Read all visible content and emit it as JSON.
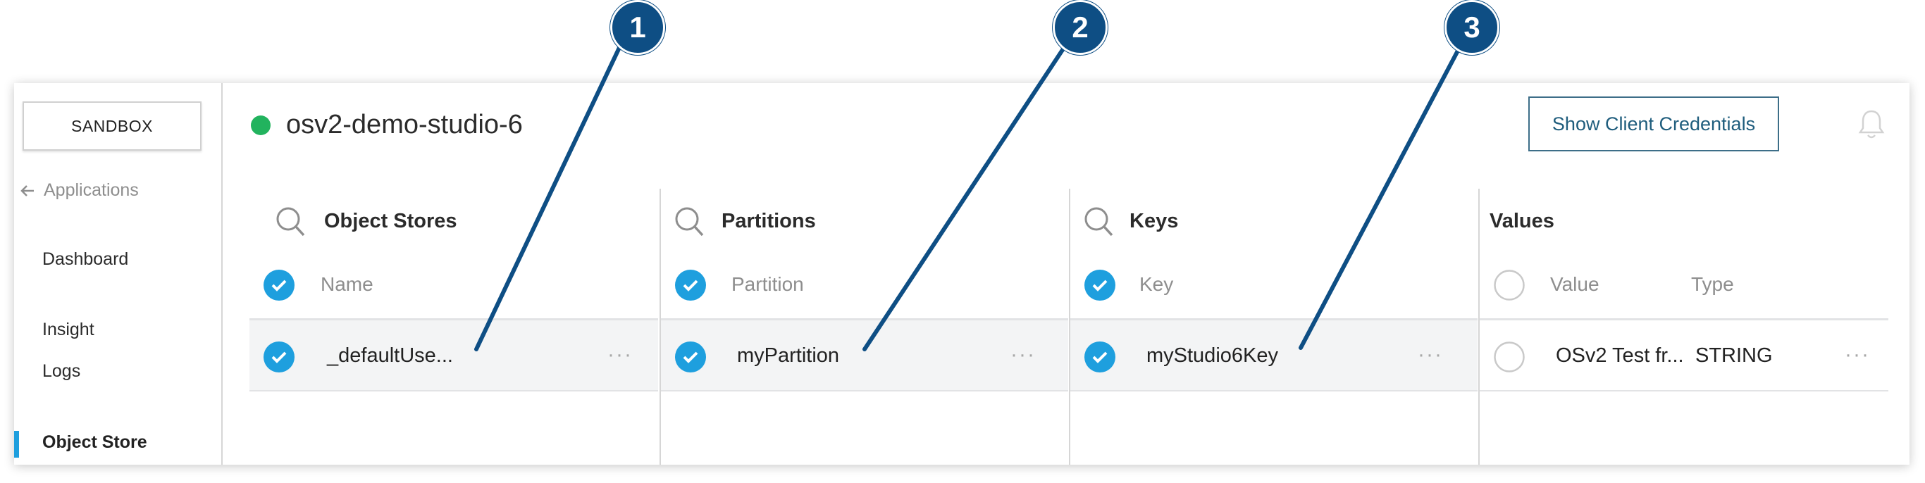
{
  "sidebar": {
    "environment": "SANDBOX",
    "back_label": "Applications",
    "items": [
      {
        "label": "Dashboard"
      },
      {
        "label": "Insight"
      },
      {
        "label": "Logs"
      },
      {
        "label": "Object Store",
        "active": true
      }
    ]
  },
  "header": {
    "app_name": "osv2-demo-studio-6",
    "status_color": "#22b35e",
    "credentials_button": "Show Client Credentials"
  },
  "columns": [
    {
      "title": "Object Stores",
      "header_label": "Name",
      "row_value": "_defaultUse..."
    },
    {
      "title": "Partitions",
      "header_label": "Partition",
      "row_value": "myPartition"
    },
    {
      "title": "Keys",
      "header_label": "Key",
      "row_value": "myStudio6Key"
    },
    {
      "title": "Values",
      "header_value_label": "Value",
      "header_type_label": "Type",
      "row_value": "OSv2 Test fr...",
      "row_type": "STRING"
    }
  ],
  "callouts": [
    "1",
    "2",
    "3"
  ],
  "colors": {
    "accent": "#1e9fde",
    "callout": "#0e4e84",
    "button_border": "#3d6e88"
  }
}
